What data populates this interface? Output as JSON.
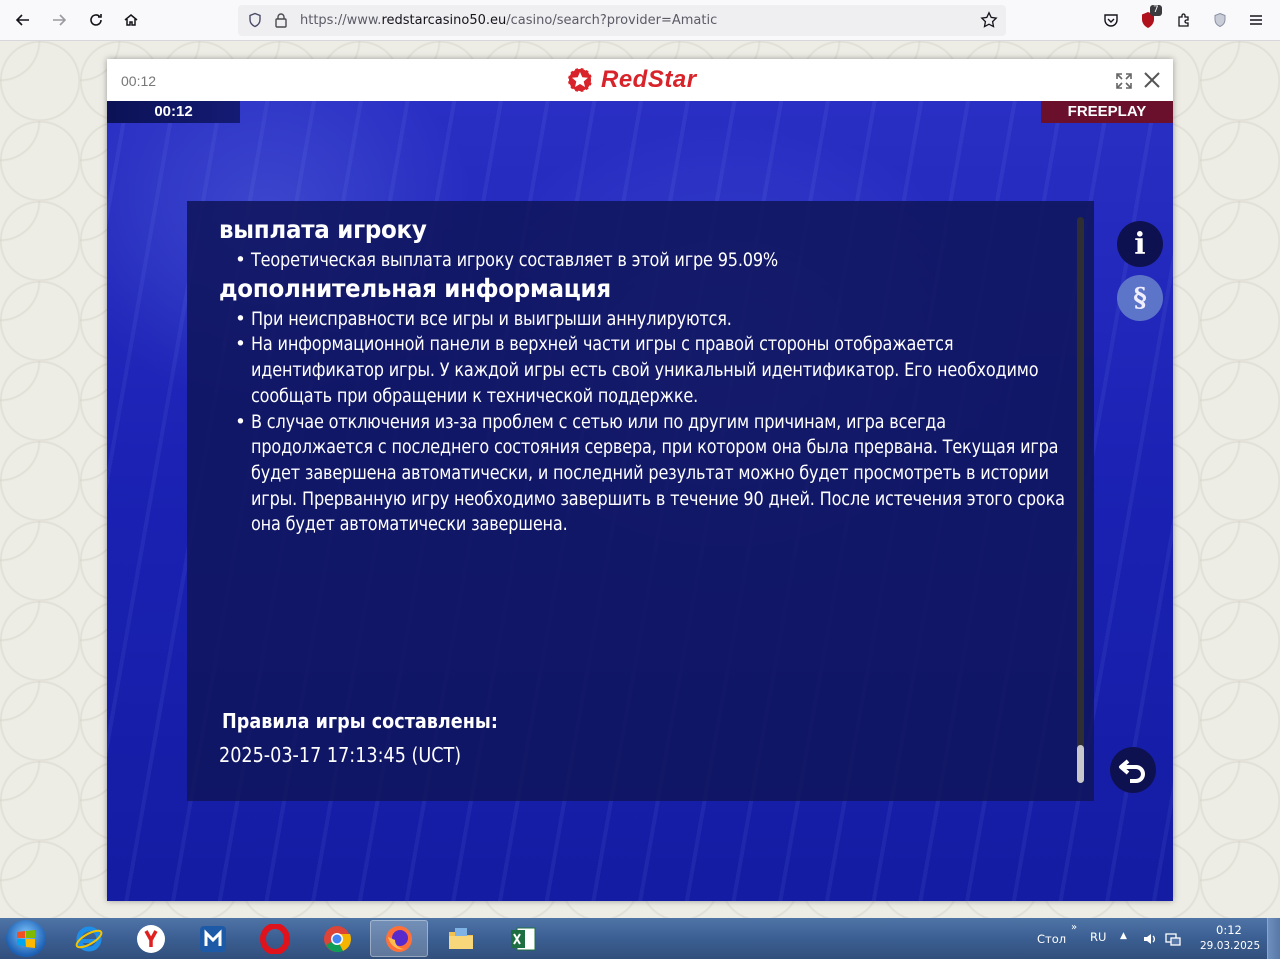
{
  "browser": {
    "url_prefix": "https://www.",
    "url_domain": "redstarcasino50.eu",
    "url_path": "/casino/search?provider=Amatic",
    "extension_badge": "7"
  },
  "modal": {
    "timer": "00:12",
    "logo_text": "RedStar"
  },
  "game": {
    "timer": "00:12",
    "mode": "FREEPLAY",
    "sections": [
      {
        "title": "выплата игроку",
        "items": [
          "Теоретическая выплата игроку составляет в этой игре 95.09%"
        ]
      },
      {
        "title": "дополнительная информация",
        "items": [
          "При неисправности все игры и выигрыши аннулируются.",
          "На информационной панели в верхней части игры с правой стороны отображается идентификатор игры. У каждой игры есть свой уникальный идентификатор. Его необходимо сообщать при обращении к технической поддержке.",
          "В случае отключения из-за проблем с сетью или по другим причинам, игра всегда продолжается с последнего состояния сервера, при котором она была прервана. Текущая игра будет завершена автоматически, и последний результат можно будет просмотреть в истории игры. Прерванную игру необходимо завершить в течение 90 дней. После истечения этого срока она будет автоматически завершена."
        ]
      }
    ],
    "rules_heading": "Правила игры составлены:",
    "rules_date": "2025-03-17 17:13:45 (UCT)",
    "info_button": "i",
    "paragraph_button": "§"
  },
  "taskbar": {
    "desktop_label": "Стол",
    "language": "RU",
    "time": "0:12",
    "date": "29.03.2025"
  }
}
